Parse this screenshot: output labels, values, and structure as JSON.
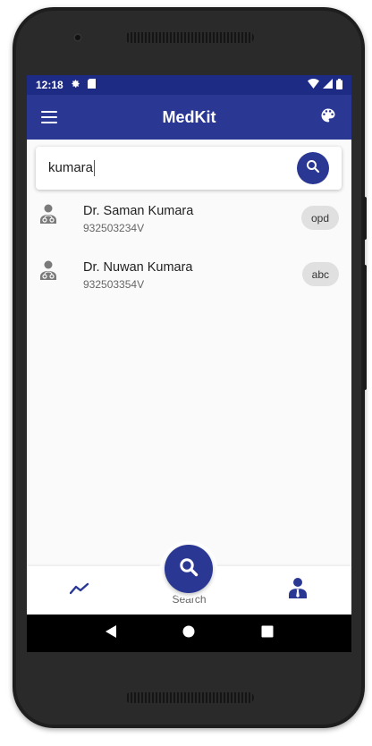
{
  "status_bar": {
    "time": "12:18",
    "icons": [
      "settings-icon",
      "sd-card-icon",
      "wifi-icon",
      "signal-icon",
      "battery-icon"
    ]
  },
  "app_bar": {
    "title": "MedKit",
    "menu_icon": "menu-icon",
    "action_icon": "palette-icon"
  },
  "search": {
    "value": "kumara",
    "button_icon": "search-icon"
  },
  "results": [
    {
      "name": "Dr. Saman Kumara",
      "id": "932503234V",
      "tag": "opd",
      "icon": "doctor-icon"
    },
    {
      "name": "Dr. Nuwan Kumara",
      "id": "932503354V",
      "tag": "abc",
      "icon": "doctor-icon"
    }
  ],
  "bottom_nav": {
    "left_icon": "trend-icon",
    "center": {
      "label": "Search",
      "icon": "search-icon"
    },
    "right_icon": "person-icon"
  },
  "colors": {
    "primary": "#2a3894",
    "status": "#1d2b84",
    "chip": "#e0e0e0"
  }
}
